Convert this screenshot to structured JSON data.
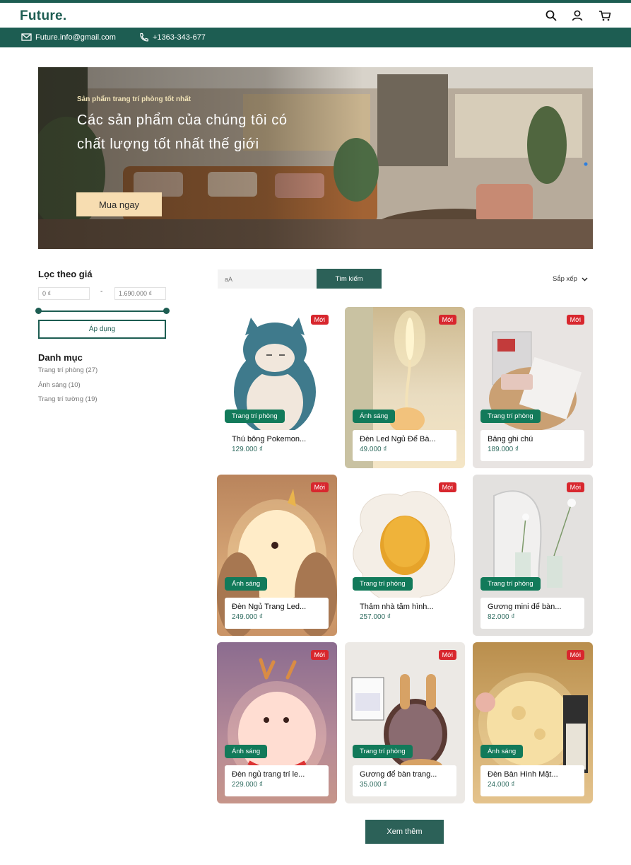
{
  "brand": {
    "logo": "Future.",
    "accent": "#1d5d52"
  },
  "header": {
    "icons": [
      "search-icon",
      "user-icon",
      "cart-icon"
    ]
  },
  "contact": {
    "email": "Future.info@gmail.com",
    "phone": "+1363-343-677"
  },
  "hero": {
    "subtitle": "Sản phẩm trang trí phòng tốt nhất",
    "title": "Các sản phẩm của chúng tôi có chất lượng tốt nhất thế giới",
    "cta": "Mua ngay"
  },
  "filter": {
    "title": "Lọc theo giá",
    "min_placeholder": "0 ₫",
    "max_placeholder": "1.690.000 ₫",
    "dash": "-",
    "apply_label": "Áp dụng"
  },
  "categories": {
    "title": "Danh mục",
    "items": [
      "Trang trí phòng (27)",
      "Ánh sáng (10)",
      "Trang trí tường (19)"
    ]
  },
  "search": {
    "placeholder": "aA",
    "button": "Tìm kiếm"
  },
  "sort": {
    "label": "Sắp xếp"
  },
  "products": [
    {
      "badge": "Mới",
      "tag": "Trang trí phòng",
      "name": "Thú bông Pokemon...",
      "price": "129.000 ₫"
    },
    {
      "badge": "Mới",
      "tag": "Ánh sáng",
      "name": "Đèn Led Ngủ Để Bà...",
      "price": "49.000 ₫"
    },
    {
      "badge": "Mới",
      "tag": "Trang trí phòng",
      "name": "Bảng ghi chú",
      "price": "189.000 ₫"
    },
    {
      "badge": "Mới",
      "tag": "Ánh sáng",
      "name": "Đèn Ngủ Trang Led...",
      "price": "249.000 ₫"
    },
    {
      "badge": "Mới",
      "tag": "Trang trí phòng",
      "name": "Thảm nhà tắm hình...",
      "price": "257.000 ₫"
    },
    {
      "badge": "Mới",
      "tag": "Trang trí phòng",
      "name": "Gương mini để bàn...",
      "price": "82.000 ₫"
    },
    {
      "badge": "Mới",
      "tag": "Ánh sáng",
      "name": "Đèn ngủ trang trí le...",
      "price": "229.000 ₫"
    },
    {
      "badge": "Mới",
      "tag": "Trang trí phòng",
      "name": "Gương để bàn trang...",
      "price": "35.000 ₫"
    },
    {
      "badge": "Mới",
      "tag": "Ánh sáng",
      "name": "Đèn Bàn Hình Mặt...",
      "price": "24.000 ₫"
    }
  ],
  "load_more": "Xem thêm"
}
